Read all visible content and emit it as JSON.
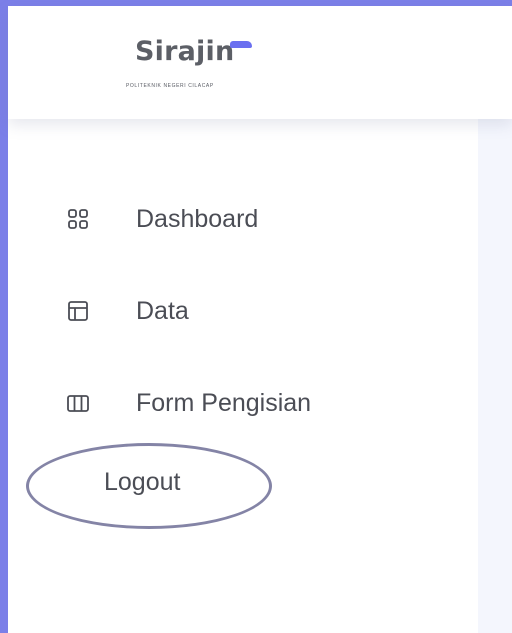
{
  "header": {
    "logo_text": "Sirajin",
    "logo_subtitle": "POLITEKNIK NEGERI CILACAP"
  },
  "sidebar": {
    "items": [
      {
        "label": "Dashboard",
        "icon": "dashboard-grid-icon"
      },
      {
        "label": "Data",
        "icon": "layout-table-icon"
      },
      {
        "label": "Form Pengisian",
        "icon": "columns-icon"
      },
      {
        "label": "Logout",
        "icon": ""
      }
    ]
  },
  "colors": {
    "window_frame": "#7b7fe8",
    "accent": "#6a6ff0",
    "text": "#4b4d55",
    "content_background": "#f4f6fd",
    "logout_highlight": "#8484a6"
  }
}
